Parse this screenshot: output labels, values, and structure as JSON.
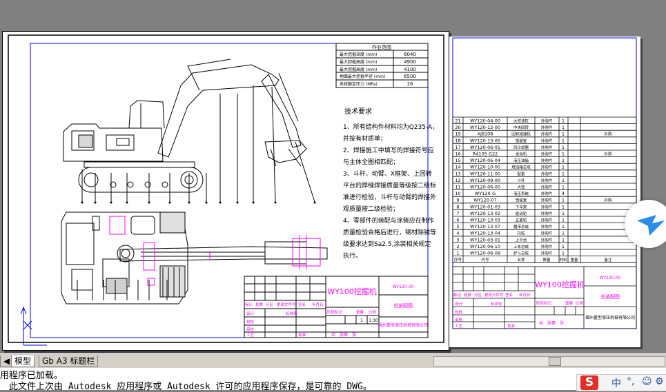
{
  "perf_table": {
    "title": "作业范围",
    "rows": [
      {
        "label": "最大挖掘深度 (mm)",
        "value": "6040"
      },
      {
        "label": "最大卸载高度 (mm)",
        "value": "4900"
      },
      {
        "label": "最大挖掘高度 (mm)",
        "value": "4100"
      },
      {
        "label": "地面最大挖掘半径 (mm)",
        "value": "6500"
      },
      {
        "label": "系统额定压力 (MPa)",
        "value": "16"
      }
    ]
  },
  "tech": {
    "title": "技术要求",
    "lines": [
      "1、所有结构件材料均为Q235-A，",
      "并按有材质单；",
      "2、焊接施工中填写的焊接符号应",
      "与主体全图相匹配；",
      "3、斗杆、动臂、X框架、上回转",
      "平台的焊缝焊接质量等级按二级标",
      "准进行检验，斗杆与动臂的焊接外",
      "观质量按二级检验；",
      "4、零部件的装配与涂装应在制作",
      "质量检验合格后进行，钢材除锈等",
      "级要求达到Sa2.5,涂装相关规定",
      "执行。"
    ]
  },
  "title_block": {
    "name": "WY100挖掘机",
    "code": "WY120-00",
    "product": "总装配图",
    "company": "福州重型液压机械有限公司",
    "weight": "1",
    "scale": "1:30",
    "headers": [
      "标记",
      "处数",
      "分区",
      "更改文件号",
      "签名",
      "年月日"
    ],
    "roles": [
      "设计",
      "校核",
      "审核",
      "工艺"
    ],
    "std": "标准化",
    "approve": "批准",
    "stage_label": "阶段标记",
    "weight_label": "重量",
    "scale_label": "比例",
    "sheet_info": "共　张第　张"
  },
  "bom": {
    "rows": [
      {
        "no": "21",
        "code": "WY120-04-00",
        "name": "大臂油缸",
        "type": "外购件",
        "qty": "1",
        "note": ""
      },
      {
        "no": "20",
        "code": "WY120-12-00",
        "name": "中央回转",
        "type": "外购件",
        "qty": "1",
        "note": ""
      },
      {
        "no": "19",
        "code": "XJ8108",
        "name": "回转减速机",
        "type": "外购件",
        "qty": "1",
        "note": "外购"
      },
      {
        "no": "18",
        "code": "WY120-13-05",
        "name": "驾驶室",
        "type": "外购件",
        "qty": "1",
        "note": ""
      },
      {
        "no": "17",
        "code": "WY120-06-01",
        "name": "风冷却器",
        "type": "外购件",
        "qty": "1",
        "note": ""
      },
      {
        "no": "16",
        "code": "R4105 G22",
        "name": "发动机",
        "type": "外购件",
        "qty": "1",
        "note": "外购"
      },
      {
        "no": "15",
        "code": "WY120-06-04",
        "name": "液压油箱",
        "type": "外购件",
        "qty": "1",
        "note": ""
      },
      {
        "no": "14",
        "code": "WY120-10-00",
        "name": "燃油箱总成",
        "type": "外购件",
        "qty": "1",
        "note": ""
      },
      {
        "no": "13",
        "code": "WY120-11-00",
        "name": "配重",
        "type": "外购件",
        "qty": "1",
        "note": ""
      },
      {
        "no": "12",
        "code": "WY120-09-00",
        "name": "斗杆",
        "type": "外购件",
        "qty": "1",
        "note": ""
      },
      {
        "no": "11",
        "code": "WY120-06-00",
        "name": "大臂",
        "type": "外购件",
        "qty": "1",
        "note": ""
      },
      {
        "no": "10",
        "code": "WY120-G",
        "name": "液压系统",
        "type": "外购件",
        "qty": "4",
        "note": ""
      },
      {
        "no": "9",
        "code": "WY120-07",
        "name": "驾驶室",
        "type": "外购件",
        "qty": "1",
        "note": "外购"
      },
      {
        "no": "8",
        "code": "WY120-01-03",
        "name": "下车架",
        "type": "外购件",
        "qty": "1",
        "note": ""
      },
      {
        "no": "7",
        "code": "WY120-13-02",
        "name": "驱动轮",
        "type": "外购件",
        "qty": "1",
        "note": ""
      },
      {
        "no": "6",
        "code": "WY120-13-03",
        "name": "支重轮",
        "type": "外购件",
        "qty": "1",
        "note": ""
      },
      {
        "no": "5",
        "code": "WY120-13-07",
        "name": "履带总成",
        "type": "外购件",
        "qty": "1",
        "note": ""
      },
      {
        "no": "4",
        "code": "WY120-13-04",
        "name": "托轮",
        "type": "外购件",
        "qty": "1",
        "note": ""
      },
      {
        "no": "3",
        "code": "WY120-03-01",
        "name": "上平台",
        "type": "外购件",
        "qty": "1",
        "note": ""
      },
      {
        "no": "2",
        "code": "WY120-06-10",
        "name": "上车总成",
        "type": "外购件",
        "qty": "1",
        "note": ""
      },
      {
        "no": "1",
        "code": "WY120-06-08",
        "name": "铲斗总成",
        "type": "外购件",
        "qty": "1",
        "note": ""
      }
    ],
    "headers": [
      "序号",
      "代号",
      "名称",
      "数量",
      "材料",
      "重量",
      "备注"
    ]
  },
  "tabs": [
    {
      "label": "模型"
    },
    {
      "label": "Gb A3 标题栏"
    }
  ],
  "cmd": {
    "line1": "用程序已加载。",
    "line2": "　此文件上次由 Autodesk 应用程序或 Autodesk 许可的应用程序保存，是可靠的 DWG。"
  },
  "ime": {
    "logo": "S",
    "lang": "中",
    "icons": [
      "°,",
      "☺",
      "⚙"
    ]
  },
  "colors": {
    "accent": "#ff00ff",
    "frame": "#0000ff",
    "bg": "#808080"
  }
}
